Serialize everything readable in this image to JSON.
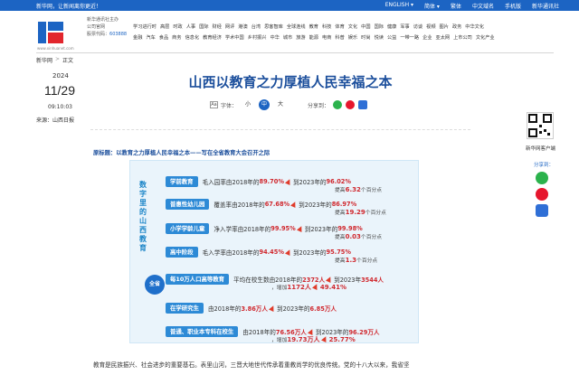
{
  "topbar": {
    "welcome": "新华网，让新闻离你更近！",
    "links": [
      "ENGLISH ▾",
      "简体 ▾",
      "繁体",
      "中文域名",
      "手机版",
      "新华通讯社"
    ]
  },
  "header": {
    "logo_text": "新华网",
    "logo_sub": "www.xinhuanet.com",
    "org_line1": "新华通讯社主办",
    "org_line2": "公司官网",
    "stock_label": "股票代码：",
    "stock_code": "603888",
    "nav_row1": [
      "学习进行时",
      "高层",
      "时政",
      "人事",
      "国际",
      "财经",
      "网评",
      "港澳",
      "台湾",
      "思客智库",
      "全球连线",
      "教育",
      "科技",
      "体育",
      "文化",
      "中国",
      "国际",
      "健康",
      "军事",
      "访谈",
      "视频",
      "图片",
      "政务",
      "中华文化"
    ],
    "nav_row2": [
      "金融",
      "汽车",
      "食品",
      "商务",
      "信息化",
      "教育经济",
      "学术中国",
      "乡村振兴",
      "中华",
      "城市",
      "旅游",
      "能源",
      "电商",
      "科普",
      "娱乐",
      "时尚",
      "悦读",
      "公益",
      "一带一路",
      "企业",
      "亚太网",
      "上市公司",
      "文化产业"
    ]
  },
  "breadcrumb": [
    "新华网",
    "正文"
  ],
  "date": {
    "year": "2024",
    "month_day": "11/29",
    "time": "09:10:03"
  },
  "source": {
    "label": "来源：",
    "value": "山西日报"
  },
  "article": {
    "title": "山西以教育之力厚植人民幸福之本",
    "font_label": "字体：",
    "font_sizes": [
      "小",
      "中",
      "大"
    ],
    "share_label": "分享到：",
    "origin_title": "原标题：以教育之力厚植人民幸福之本——写在全省教育大会召开之际",
    "first_line": "教育是民族振兴、社会进步的重要基石。表里山河，三晋大地世代传承着重教尚学的优良传统。党的十八大以来，我省坚"
  },
  "infographic": {
    "vertical_title": "数字里的山西教育",
    "sheng": "全省",
    "rows": [
      {
        "cat": "学前教育",
        "pre": "毛入园率由2018年的",
        "v1": "89.70%",
        "mid": "到2023年的",
        "v2": "96.02%",
        "gain_pre": "提高",
        "gain": "6.32",
        "gain_post": "个百分点"
      },
      {
        "cat": "普惠性幼儿园",
        "pre": "覆盖率由2018年的",
        "v1": "67.68%",
        "mid": "到2023年的",
        "v2": "86.97%",
        "gain_pre": "提高",
        "gain": "19.29",
        "gain_post": "个百分点"
      },
      {
        "cat": "小学学龄儿童",
        "pre": "净入学率由2018年的",
        "v1": "99.95%",
        "mid": "到2023年的",
        "v2": "99.98%",
        "gain_pre": "提高",
        "gain": "0.03",
        "gain_post": "个百分点"
      },
      {
        "cat": "高中阶段",
        "pre": "毛入学率由2018年的",
        "v1": "94.45%",
        "mid": "到2023年的",
        "v2": "95.75%",
        "gain_pre": "提高",
        "gain": "1.3",
        "gain_post": "个百分点"
      },
      {
        "cat": "每10万人口高等教育",
        "pre": "平均在校生数由2018年的",
        "v1": "2372人",
        "mid": "到2023年",
        "v2": "3544人",
        "gain_pre": "，增加",
        "gain": "1172人",
        "gain_post": "",
        "pct": "49.41%"
      },
      {
        "cat": "在学研究生",
        "pre": "由2018年的",
        "v1": "3.86万人",
        "mid": "到2023年的",
        "v2": "6.85万人"
      },
      {
        "cat": "普通、职业本专科在校生",
        "pre": "由2018年的",
        "v1": "76.56万人",
        "mid": "到2023年的",
        "v2": "96.29万人",
        "gain_pre": "，增加",
        "gain": "19.73万人",
        "gain_post": "",
        "pct": "25.77%"
      }
    ]
  },
  "right": {
    "qr_label": "新华网客户端",
    "share_label": "分享到："
  }
}
